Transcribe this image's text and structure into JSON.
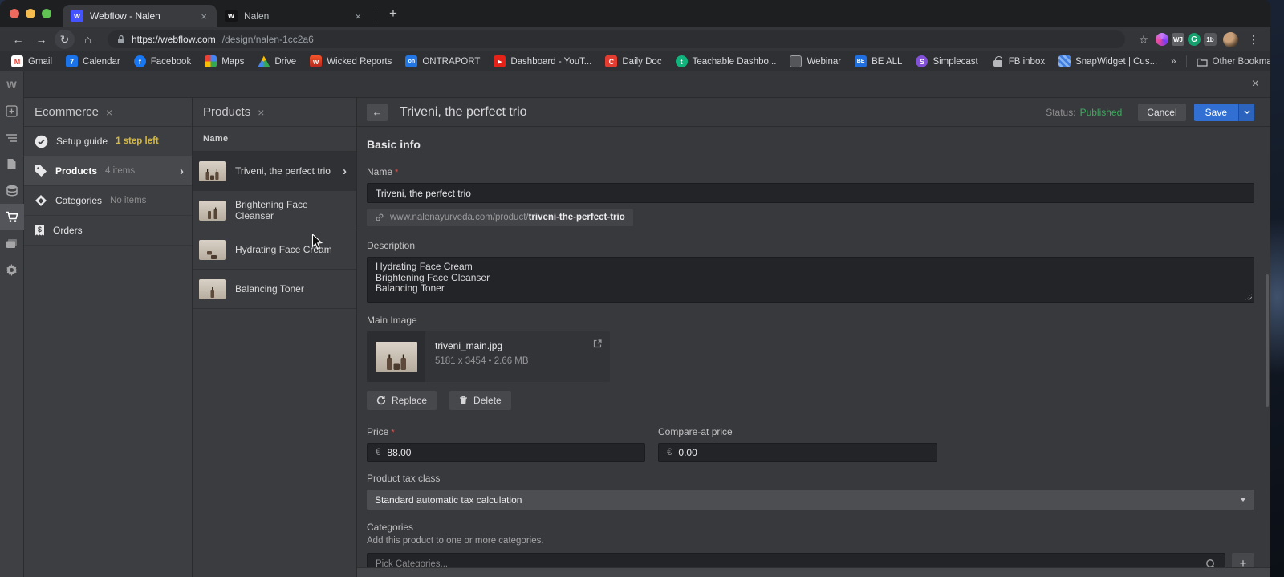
{
  "colors": {
    "save_blue": "#3170d2",
    "published_green": "#3cab5e",
    "warning_yellow": "#d4b83e",
    "required_red": "#e0564f",
    "webflow_blue": "#4353ff"
  },
  "browser": {
    "tabs": [
      {
        "title": "Webflow - Nalen",
        "favicon": "w",
        "close": "×"
      },
      {
        "title": "Nalen",
        "favicon": "w",
        "close": "×"
      }
    ],
    "new_tab": "+",
    "nav": {
      "back": "←",
      "forward": "→",
      "reload": "↻",
      "home": "⌂"
    },
    "url_host": "https://webflow.com",
    "url_path": "/design/nalen-1cc2a6",
    "star": "☆",
    "extensions": {
      "wj": "WJ",
      "g": "G",
      "ob": "1b"
    },
    "menu_dots": "⋮",
    "bookmarks": [
      {
        "label": "Gmail",
        "icon": "M"
      },
      {
        "label": "Calendar",
        "icon": "7"
      },
      {
        "label": "Facebook",
        "icon": "f"
      },
      {
        "label": "Maps",
        "icon": ""
      },
      {
        "label": "Drive",
        "icon": ""
      },
      {
        "label": "Wicked Reports",
        "icon": "w"
      },
      {
        "label": "ONTRAPORT",
        "icon": "on"
      },
      {
        "label": "Dashboard - YouT...",
        "icon": "▶"
      },
      {
        "label": "Daily Doc",
        "icon": "C"
      },
      {
        "label": "Teachable Dashbo...",
        "icon": "t"
      },
      {
        "label": "Webinar",
        "icon": ""
      },
      {
        "label": "BE ALL",
        "icon": "BE"
      },
      {
        "label": "Simplecast",
        "icon": "S"
      },
      {
        "label": "FB inbox",
        "icon": ""
      },
      {
        "label": "SnapWidget | Cus...",
        "icon": ""
      }
    ],
    "bookmarks_overflow": "»",
    "other_bookmarks": "Other Bookmarks"
  },
  "rail": {
    "logo": "w"
  },
  "topbar": {
    "close": "×"
  },
  "ecommerce_panel": {
    "title": "Ecommerce",
    "close": "×",
    "items": [
      {
        "label": "Setup guide",
        "meta": "1 step left"
      },
      {
        "label": "Products",
        "meta": "4 items",
        "chevron": "›"
      },
      {
        "label": "Categories",
        "meta": "No items"
      },
      {
        "label": "Orders",
        "meta": ""
      }
    ]
  },
  "products_panel": {
    "title": "Products",
    "close": "×",
    "column": "Name",
    "rows": [
      {
        "name": "Triveni, the perfect trio",
        "chevron": "›"
      },
      {
        "name": "Brightening Face Cleanser"
      },
      {
        "name": "Hydrating Face Cream"
      },
      {
        "name": "Balancing Toner"
      }
    ]
  },
  "editor": {
    "back": "←",
    "title": "Triveni, the perfect trio",
    "status_label": "Status:",
    "status_value": "Published",
    "cancel": "Cancel",
    "save": "Save",
    "basic_info": "Basic info",
    "name": {
      "label": "Name",
      "required": "*",
      "value": "Triveni, the perfect trio"
    },
    "slug": {
      "prefix": "www.nalenayurveda.com/product/",
      "value": "triveni-the-perfect-trio"
    },
    "description": {
      "label": "Description",
      "value": "Hydrating Face Cream\nBrightening Face Cleanser\nBalancing Toner"
    },
    "main_image": {
      "label": "Main Image",
      "filename": "triveni_main.jpg",
      "meta": "5181 x 3454 • 2.66 MB",
      "replace": "Replace",
      "delete": "Delete"
    },
    "price": {
      "label": "Price",
      "required": "*",
      "currency": "€",
      "value": "88.00"
    },
    "compare_price": {
      "label": "Compare-at price",
      "currency": "€",
      "value": "0.00"
    },
    "tax": {
      "label": "Product tax class",
      "value": "Standard automatic tax calculation"
    },
    "categories": {
      "label": "Categories",
      "help": "Add this product to one or more categories.",
      "placeholder": "Pick Categories...",
      "add": "+"
    }
  }
}
